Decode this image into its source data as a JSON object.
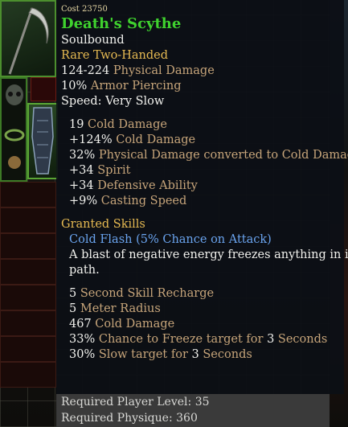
{
  "item": {
    "cost_label": "Cost 23750",
    "name": "Death's Scythe",
    "binding": "Soulbound",
    "rarity_type": "Rare Two-Handed",
    "base_stats": [
      {
        "value": "124-224",
        "label": " Physical Damage"
      },
      {
        "value": "10%",
        "label": " Armor Piercing"
      }
    ],
    "speed": "Speed:  Very Slow",
    "bonus_stats": [
      {
        "value": "19",
        "label": " Cold Damage"
      },
      {
        "value": "+124%",
        "label": " Cold Damage"
      },
      {
        "value": "32%",
        "label": " Physical Damage converted to Cold Damage"
      },
      {
        "value": "+34",
        "label": " Spirit"
      },
      {
        "value": "+34",
        "label": " Defensive Ability"
      },
      {
        "value": "+9%",
        "label": " Casting Speed"
      }
    ],
    "granted_header": "Granted Skills",
    "skill_name": "Cold Flash (5% Chance on Attack)",
    "skill_desc_1": "A blast of negative energy freezes anything in its",
    "skill_desc_2": "path.",
    "skill_stats": [
      {
        "value": "5",
        "label": " Second Skill Recharge",
        "value2": "",
        "label2": ""
      },
      {
        "value": "5",
        "label": " Meter Radius",
        "value2": "",
        "label2": ""
      },
      {
        "value": "467",
        "label": " Cold Damage",
        "value2": "",
        "label2": ""
      },
      {
        "value": "33%",
        "label": " Chance to Freeze target for ",
        "value2": "3",
        "label2": " Seconds"
      },
      {
        "value": "30%",
        "label": " Slow target for ",
        "value2": "3",
        "label2": " Seconds"
      }
    ],
    "req_level_label": "Required Player Level: ",
    "req_level_value": "35",
    "req_phys_label": "Required Physique: ",
    "req_phys_value": "360"
  },
  "colors": {
    "name": "#3fd22e",
    "rarity": "#e6ba52",
    "stat_value": "#f2f2ee",
    "stat_label": "#c7a57a",
    "skill": "#6aa4ef"
  },
  "icons": [
    "scythe-icon",
    "armor-icon",
    "ring-icon",
    "amulet-icon"
  ]
}
